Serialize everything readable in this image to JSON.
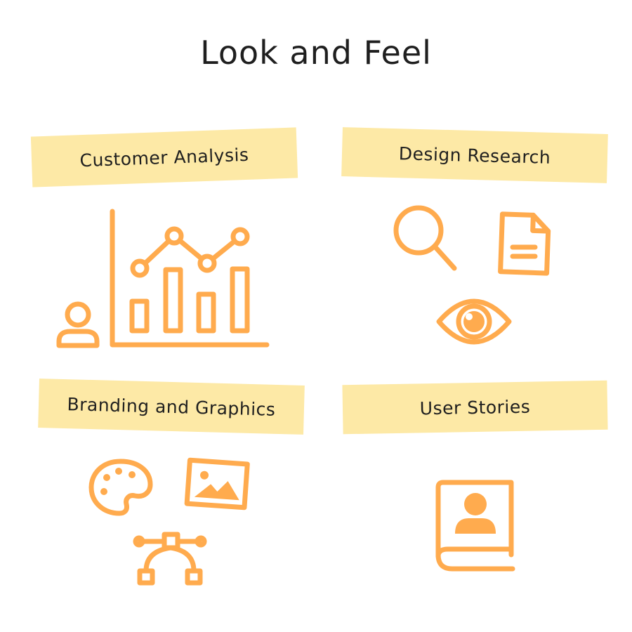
{
  "title": "Look and Feel",
  "accent_color": "#ffab4e",
  "label_color": "#fde9a6",
  "sections": [
    {
      "label": "Customer Analysis",
      "icons": [
        "person-icon",
        "bar-chart-icon",
        "line-chart-icon"
      ]
    },
    {
      "label": "Design Research",
      "icons": [
        "magnifier-icon",
        "document-icon",
        "eye-icon"
      ]
    },
    {
      "label": "Branding and Graphics",
      "icons": [
        "palette-icon",
        "image-icon",
        "bezier-pen-icon"
      ]
    },
    {
      "label": "User Stories",
      "icons": [
        "user-book-icon"
      ]
    }
  ]
}
